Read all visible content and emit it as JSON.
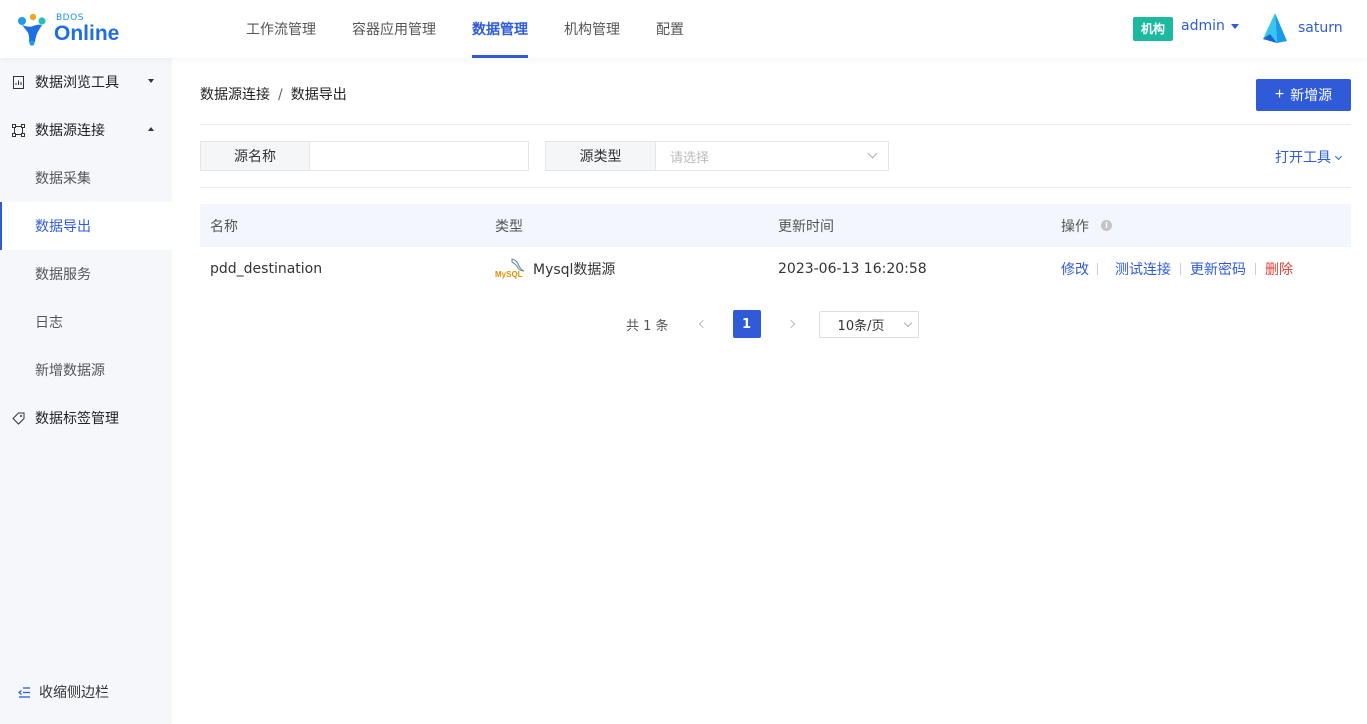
{
  "header": {
    "logo_small": "BDOS",
    "logo_big": "Online",
    "nav": [
      {
        "label": "工作流管理",
        "active": false
      },
      {
        "label": "容器应用管理",
        "active": false
      },
      {
        "label": "数据管理",
        "active": true
      },
      {
        "label": "机构管理",
        "active": false
      },
      {
        "label": "配置",
        "active": false
      }
    ],
    "org_badge": "机构",
    "user": "admin",
    "app_name": "saturn"
  },
  "sidebar": {
    "items": [
      {
        "label": "数据浏览工具",
        "type": "group",
        "icon": "file-chart-icon",
        "expanded": false
      },
      {
        "label": "数据源连接",
        "type": "group",
        "icon": "connection-icon",
        "expanded": true
      },
      {
        "label": "数据采集",
        "type": "sub",
        "active": false
      },
      {
        "label": "数据导出",
        "type": "sub",
        "active": true
      },
      {
        "label": "数据服务",
        "type": "sub",
        "active": false
      },
      {
        "label": "日志",
        "type": "sub",
        "active": false
      },
      {
        "label": "新增数据源",
        "type": "sub",
        "active": false
      },
      {
        "label": "数据标签管理",
        "type": "group",
        "icon": "tag-icon",
        "expanded": null
      }
    ],
    "collapse_label": "收缩侧边栏"
  },
  "breadcrumb": {
    "parent": "数据源连接",
    "separator": "/",
    "current": "数据导出"
  },
  "add_button": {
    "icon": "plus-icon",
    "label": "新增源"
  },
  "filters": {
    "name_label": "源名称",
    "name_value": "",
    "type_label": "源类型",
    "type_placeholder": "请选择",
    "open_tool": "打开工具"
  },
  "table": {
    "headers": [
      "名称",
      "类型",
      "更新时间",
      "操作"
    ],
    "rows": [
      {
        "name": "pdd_destination",
        "type_logo_text": "MySQL",
        "type": "Mysql数据源",
        "updated": "2023-06-13 16:20:58",
        "actions": [
          "修改",
          "测试连接",
          "更新密码",
          "删除"
        ]
      }
    ]
  },
  "pagination": {
    "total": "共 1 条",
    "current_page": "1",
    "page_size": "10条/页"
  },
  "colors": {
    "primary": "#2f5bd8",
    "badge": "#1bb9a0",
    "danger": "#e0403b",
    "sidebar_bg": "#f5f7fb"
  }
}
